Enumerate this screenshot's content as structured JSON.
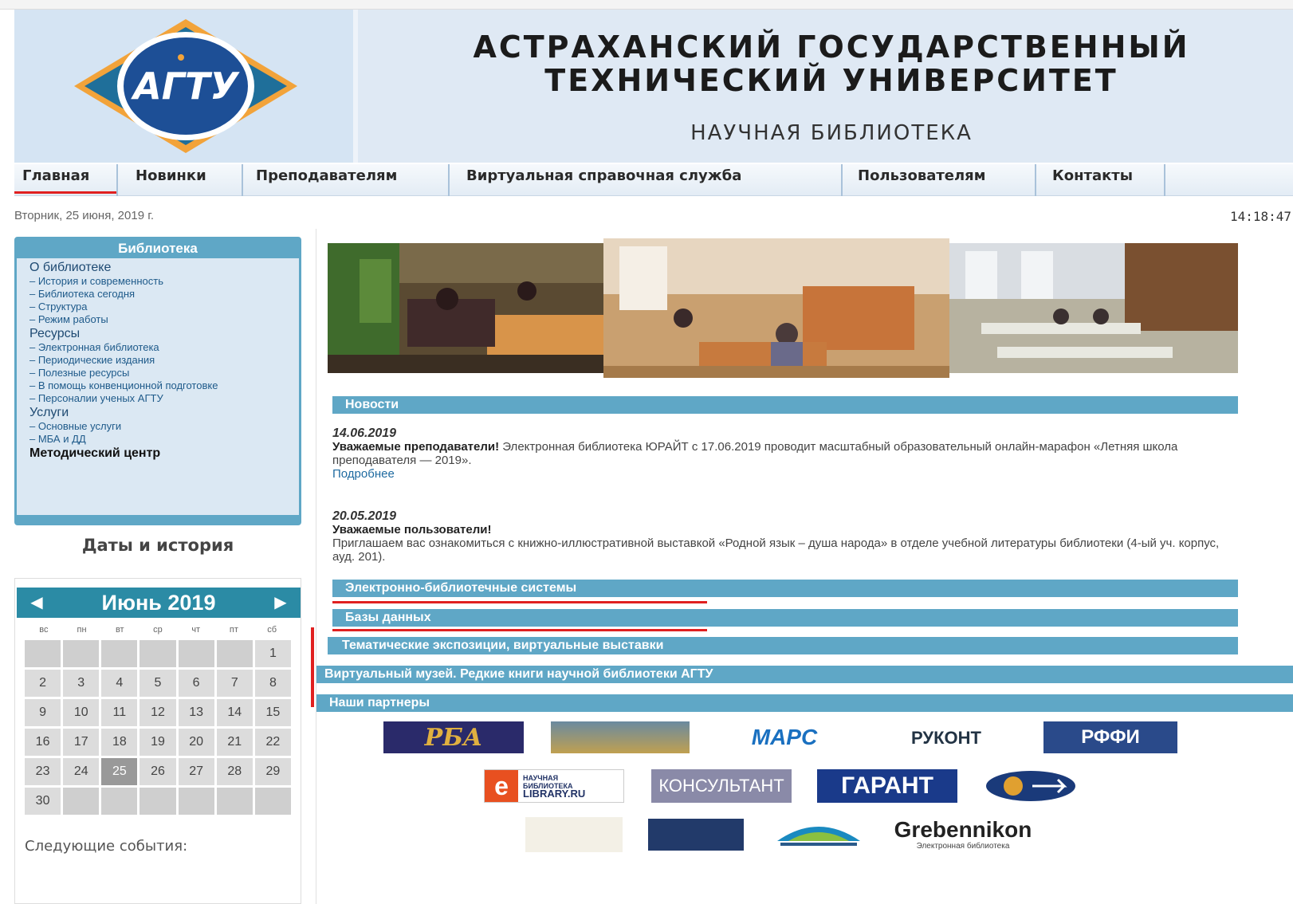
{
  "header": {
    "logo_text": "АГТУ",
    "title_line1": "АСТРАХАНСКИЙ ГОСУДАРСТВЕННЫЙ",
    "title_line2": "ТЕХНИЧЕСКИЙ УНИВЕРСИТЕТ",
    "subtitle": "НАУЧНАЯ БИБЛИОТЕКА"
  },
  "nav": {
    "items": [
      "Главная",
      "Новинки",
      "Преподавателям",
      "Виртуальная справочная служба",
      "Пользователям",
      "Контакты"
    ]
  },
  "date_text": "Вторник, 25 июня, 2019 г.",
  "clock": "14:18:47",
  "sidebar": {
    "title": "Библиотека",
    "menu": [
      {
        "type": "h",
        "label": "О библиотеке"
      },
      {
        "type": "s",
        "label": "– История и современность"
      },
      {
        "type": "s",
        "label": "– Библиотека сегодня"
      },
      {
        "type": "s",
        "label": "– Структура"
      },
      {
        "type": "s",
        "label": "– Режим работы"
      },
      {
        "type": "h",
        "label": "Ресурсы"
      },
      {
        "type": "s",
        "label": "– Электронная библиотека"
      },
      {
        "type": "s",
        "label": "– Периодические издания"
      },
      {
        "type": "s",
        "label": "– Полезные ресурсы"
      },
      {
        "type": "s",
        "label": "– В помощь конвенционной подготовке"
      },
      {
        "type": "s",
        "label": "– Персоналии ученых АГТУ"
      },
      {
        "type": "h",
        "label": "Услуги"
      },
      {
        "type": "s",
        "label": "– Основные услуги"
      },
      {
        "type": "s",
        "label": "– МБА и ДД"
      },
      {
        "type": "b",
        "label": "Методический центр"
      }
    ],
    "dates_title": "Даты и история"
  },
  "calendar": {
    "title": "Июнь 2019",
    "prev": "◀",
    "next": "▶",
    "dow": [
      "вс",
      "пн",
      "вт",
      "ср",
      "чт",
      "пт",
      "сб"
    ],
    "weeks": [
      [
        "",
        "",
        "",
        "",
        "",
        "",
        "1"
      ],
      [
        "2",
        "3",
        "4",
        "5",
        "6",
        "7",
        "8"
      ],
      [
        "9",
        "10",
        "11",
        "12",
        "13",
        "14",
        "15"
      ],
      [
        "16",
        "17",
        "18",
        "19",
        "20",
        "21",
        "22"
      ],
      [
        "23",
        "24",
        "25",
        "26",
        "27",
        "28",
        "29"
      ],
      [
        "30",
        "",
        "",
        "",
        "",
        "",
        ""
      ]
    ],
    "today": "25",
    "next_events": "Следующие события:"
  },
  "news": {
    "header": "Новости",
    "items": [
      {
        "date": "14.06.2019",
        "title": "Уважаемые преподаватели!",
        "text": " Электронная библиотека ЮРАЙТ с 17.06.2019 проводит масштабный образовательный онлайн-марафон «Летняя школа преподавателя — 2019».",
        "more": "Подробнее"
      },
      {
        "date": "20.05.2019",
        "title": "Уважаемые пользователи!",
        "text": "Приглашаем вас ознакомиться с книжно-иллюстративной выставкой «Родной язык – душа народа» в отделе учебной литературы библиотеки (4-ый уч. корпус, ауд. 201)."
      }
    ]
  },
  "sections": {
    "ebs": "Электронно-библиотечные системы",
    "db": "Базы данных",
    "expo": "Тематические экспозиции, виртуальные выставки",
    "museum": "Виртуальный музей. Редкие книги научной библиотеки АГТУ",
    "partners": "Наши партнеры"
  },
  "partners": {
    "rba": "РБА",
    "mars": "МАРС",
    "rukont": "РУКОНТ",
    "rffi": "РФФИ",
    "elibrary_line1": "НАУЧНАЯ",
    "elibrary_line2": "БИБЛИОТЕКА",
    "elibrary_line3": "LIBRARY.RU",
    "konsultant": "КОНСУЛЬТАНТ",
    "garant": "ГАРАНТ",
    "grebennikon": "Grebennikon",
    "grebennikon_sub": "Электронная библиотека"
  },
  "colors": {
    "accent": "#5fa7c6",
    "calendar_head": "#2b8ba5",
    "active_underline": "#e02020"
  }
}
